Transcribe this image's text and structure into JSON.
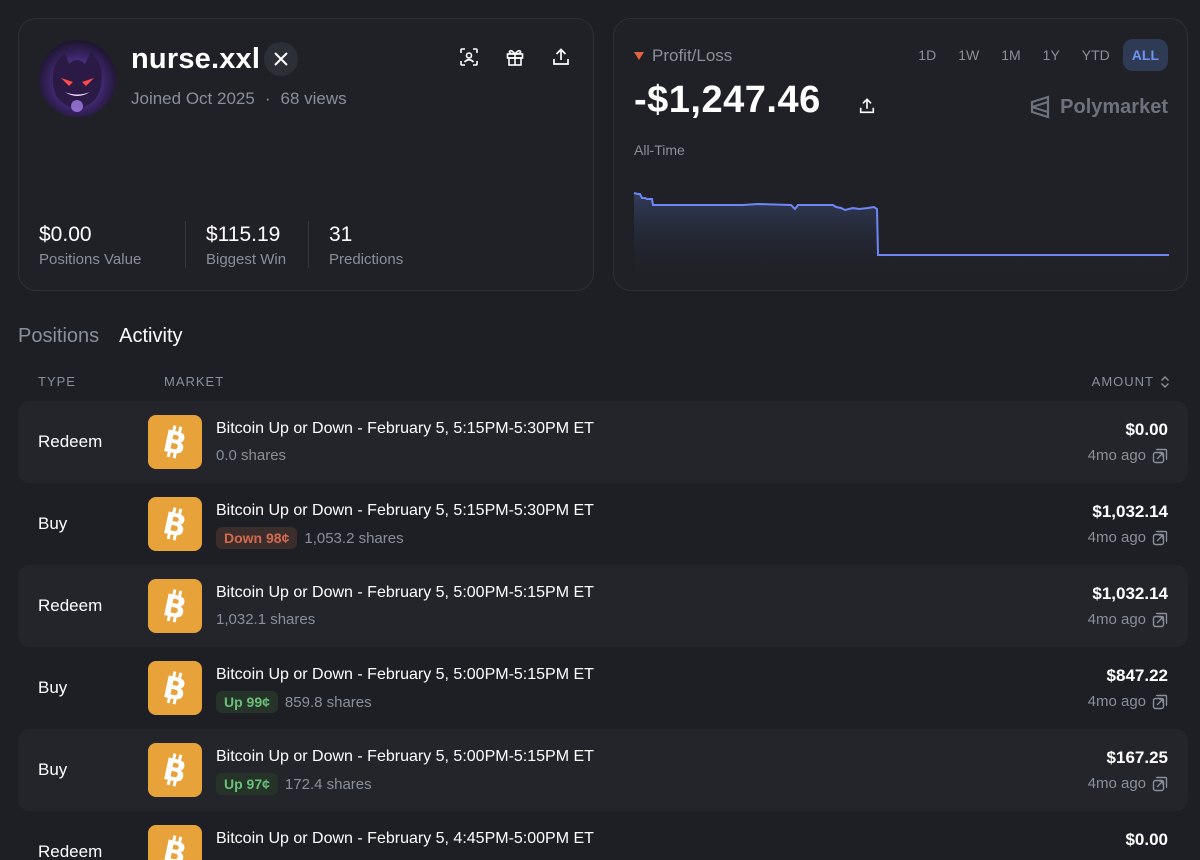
{
  "profile": {
    "username": "nurse.xxl",
    "joined": "Joined Oct 2025",
    "dot": "·",
    "views": "68 views",
    "stats": [
      {
        "value": "$0.00",
        "label": "Positions Value"
      },
      {
        "value": "$115.19",
        "label": "Biggest Win"
      },
      {
        "value": "31",
        "label": "Predictions"
      }
    ]
  },
  "pnl": {
    "label": "Profit/Loss",
    "value": "-$1,247.46",
    "brand": "Polymarket",
    "range_label": "All-Time",
    "periods": [
      "1D",
      "1W",
      "1M",
      "1Y",
      "YTD",
      "ALL"
    ],
    "active_period": "ALL",
    "line_color": "#6f86f6",
    "trend_color": "#e0623e"
  },
  "tabs": [
    "Positions",
    "Activity"
  ],
  "active_tab": "Activity",
  "columns": {
    "type": "TYPE",
    "market": "MARKET",
    "amount": "AMOUNT"
  },
  "activity": [
    {
      "type": "Redeem",
      "title": "Bitcoin Up or Down - February 5, 5:15PM-5:30PM ET",
      "outcome": "",
      "outcome_kind": "",
      "shares": "0.0 shares",
      "amount": "$0.00",
      "time": "4mo ago"
    },
    {
      "type": "Buy",
      "title": "Bitcoin Up or Down - February 5, 5:15PM-5:30PM ET",
      "outcome": "Down 98¢",
      "outcome_kind": "down",
      "shares": "1,053.2 shares",
      "amount": "$1,032.14",
      "time": "4mo ago"
    },
    {
      "type": "Redeem",
      "title": "Bitcoin Up or Down - February 5, 5:00PM-5:15PM ET",
      "outcome": "",
      "outcome_kind": "",
      "shares": "1,032.1 shares",
      "amount": "$1,032.14",
      "time": "4mo ago"
    },
    {
      "type": "Buy",
      "title": "Bitcoin Up or Down - February 5, 5:00PM-5:15PM ET",
      "outcome": "Up 99¢",
      "outcome_kind": "up",
      "shares": "859.8 shares",
      "amount": "$847.22",
      "time": "4mo ago"
    },
    {
      "type": "Buy",
      "title": "Bitcoin Up or Down - February 5, 5:00PM-5:15PM ET",
      "outcome": "Up 97¢",
      "outcome_kind": "up",
      "shares": "172.4 shares",
      "amount": "$167.25",
      "time": "4mo ago"
    },
    {
      "type": "Redeem",
      "title": "Bitcoin Up or Down - February 5, 4:45PM-5:00PM ET",
      "outcome": "",
      "outcome_kind": "",
      "shares": "",
      "amount": "$0.00",
      "time": ""
    }
  ],
  "icons": {
    "coin": "bitcoin-icon",
    "external": "external-link-icon",
    "share": "share-icon",
    "gift": "gift-icon",
    "scan": "scan-face-icon",
    "x": "x-logo-icon",
    "sort": "sort-icon"
  }
}
